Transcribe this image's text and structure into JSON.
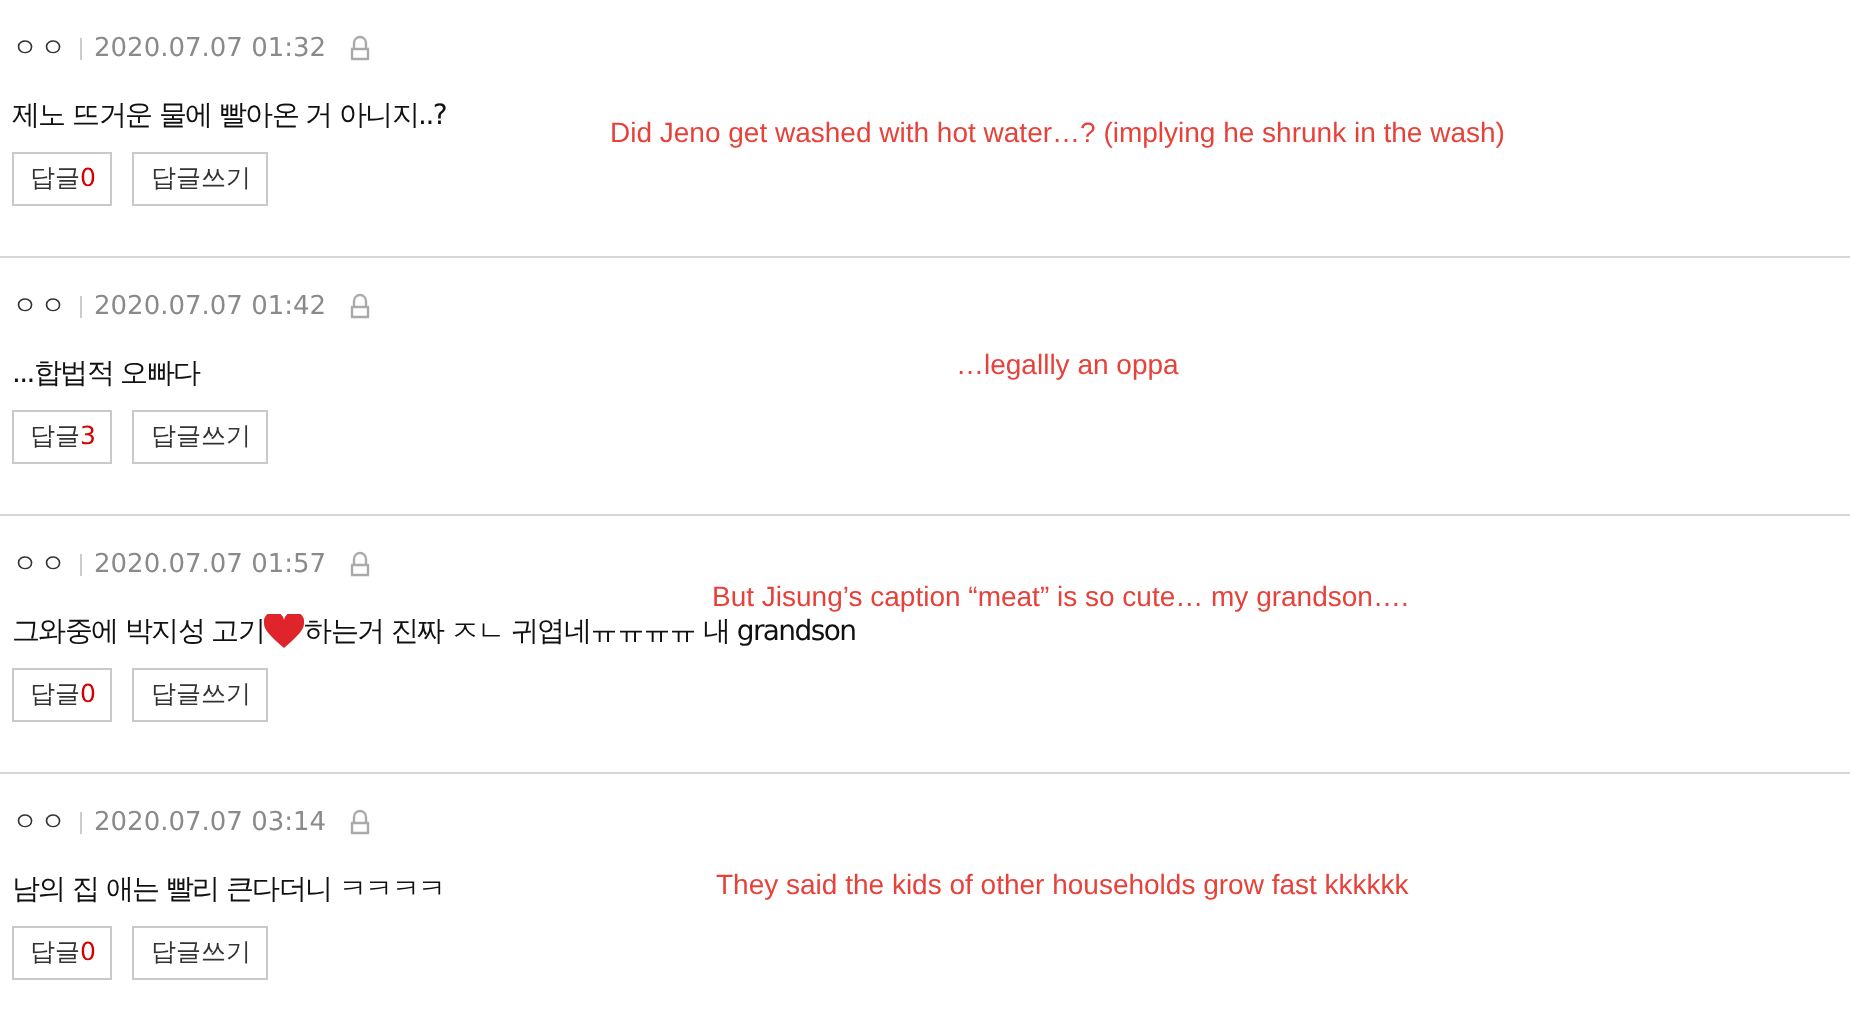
{
  "comments": [
    {
      "author": "ㅇㅇ",
      "date": "2020.07.07 01:32",
      "text": "제노 뜨거운 물에 빨아온 거 아니지..?",
      "heart": false,
      "reply_label": "답글",
      "reply_count": "0",
      "write_label": "답글쓰기",
      "translation": "Did Jeno get washed with hot water…? (implying he shrunk in the wash)"
    },
    {
      "author": "ㅇㅇ",
      "date": "2020.07.07 01:42",
      "text": "...합법적 오빠다",
      "heart": false,
      "reply_label": "답글",
      "reply_count": "3",
      "write_label": "답글쓰기",
      "translation": "…legallly an oppa"
    },
    {
      "author": "ㅇㅇ",
      "date": "2020.07.07 01:57",
      "text": "그와중에 박지성 고기",
      "heart": true,
      "text_after": "하는거 진짜 ㅈㄴ 귀엽네ㅠㅠㅠㅠ 내 grandson",
      "reply_label": "답글",
      "reply_count": "0",
      "write_label": "답글쓰기",
      "translation": "But Jisung’s caption “meat” is so cute… my grandson…."
    },
    {
      "author": "ㅇㅇ",
      "date": "2020.07.07 03:14",
      "text": "남의 집 애는 빨리 큰다더니 ㅋㅋㅋㅋ",
      "heart": false,
      "reply_label": "답글",
      "reply_count": "0",
      "write_label": "답글쓰기",
      "translation": "They said the kids of other households grow fast kkkkkk"
    }
  ]
}
